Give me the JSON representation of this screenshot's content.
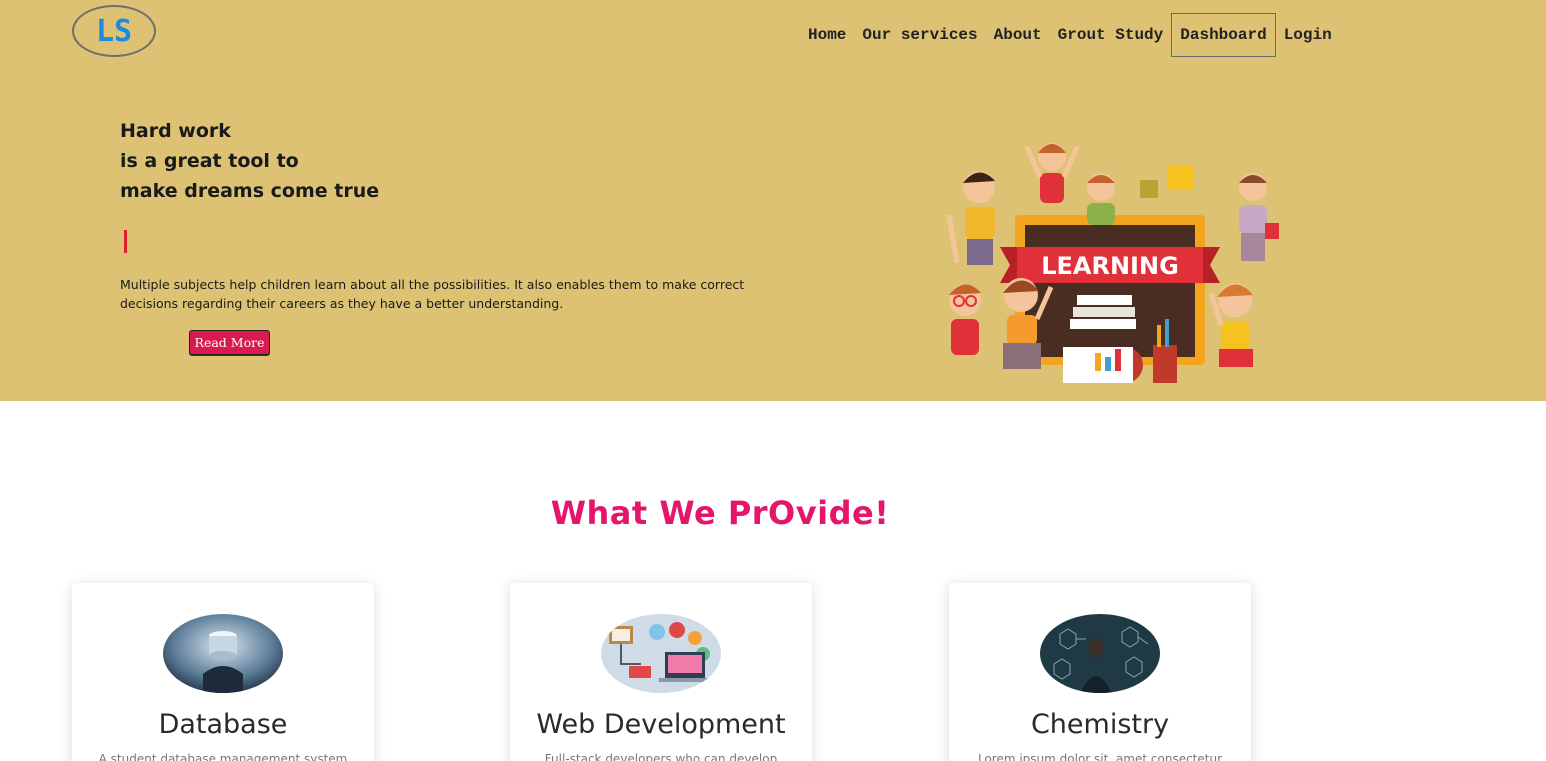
{
  "logo": {
    "text": "LS"
  },
  "nav": {
    "items": [
      "Home",
      "Our services",
      "About",
      "Grout Study",
      "Dashboard",
      "Login"
    ]
  },
  "hero": {
    "title_lines": [
      "Hard work",
      "is a great tool to",
      "make dreams come true"
    ],
    "description": "Multiple subjects help children learn about all the possibilities. It also enables them to make correct decisions regarding their careers as they have a better understanding.",
    "button": "Read More",
    "illustration_banner": "LEARNING"
  },
  "section": {
    "title": "What We PrOvide!"
  },
  "cards": [
    {
      "title": "Database",
      "desc": "A student database management system"
    },
    {
      "title": "Web Development",
      "desc": "Full-stack developers who can develop"
    },
    {
      "title": "Chemistry",
      "desc": "Lorem ipsum dolor sit, amet consectetur"
    }
  ],
  "colors": {
    "hero_bg": "#dec274",
    "accent_pink": "#e5156b",
    "button_bg": "#d81a4e",
    "logo_blue": "#1a8be0"
  }
}
